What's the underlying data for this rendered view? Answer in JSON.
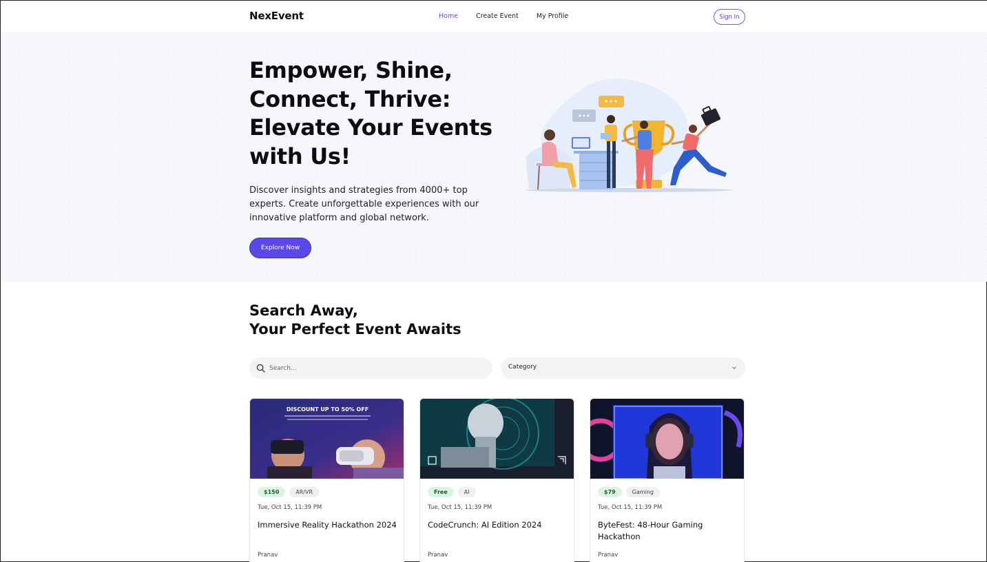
{
  "nav": {
    "brand": "NexEvent",
    "links": [
      {
        "label": "Home",
        "active": true
      },
      {
        "label": "Create Event",
        "active": false
      },
      {
        "label": "My Profile",
        "active": false
      }
    ],
    "signin_label": "Sign In"
  },
  "hero": {
    "title": "Empower, Shine, Connect, Thrive: Elevate Your Events with Us!",
    "subtitle": "Discover insights and strategies from 4000+ top experts. Create unforgettable experiences with our innovative platform and global network.",
    "cta_label": "Explore Now"
  },
  "search_section": {
    "title_line1": "Search Away,",
    "title_line2": "Your Perfect Event Awaits",
    "search_placeholder": "Search...",
    "category_label": "Category"
  },
  "events": [
    {
      "price": "$150",
      "category": "AR/VR",
      "date": "Tue, Oct 15, 11:39 PM",
      "title": "Immersive Reality Hackathon 2024",
      "author": "Pranav",
      "banner_text": "DISCOUNT UP TO 50% OFF"
    },
    {
      "price": "Free",
      "category": "AI",
      "date": "Tue, Oct 15, 11:39 PM",
      "title": "CodeCrunch: AI Edition 2024",
      "author": "Pranav"
    },
    {
      "price": "$79",
      "category": "Gaming",
      "date": "Tue, Oct 15, 11:39 PM",
      "title": "ByteFest: 48-Hour Gaming Hackathon",
      "author": "Pranav"
    }
  ],
  "colors": {
    "accent": "#5b48e8",
    "price_tag_bg": "#dcf5e3",
    "hero_bg": "#f6f7fb"
  }
}
